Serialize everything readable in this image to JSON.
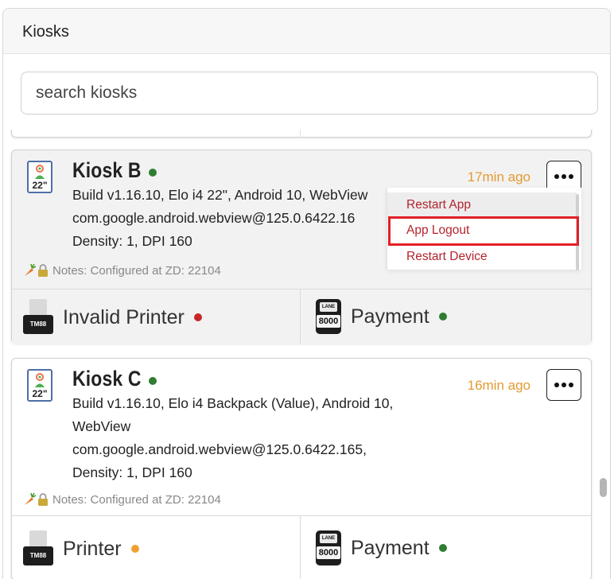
{
  "panel": {
    "title": "Kiosks"
  },
  "search": {
    "placeholder": "search kiosks"
  },
  "colors": {
    "online": "#2f7d32",
    "error": "#c62828",
    "warning": "#f0a030",
    "time": "#e39a33",
    "menu_text": "#b3242e",
    "highlight": "#e21f26"
  },
  "kiosks": [
    {
      "name": "Kiosk B",
      "status": "online",
      "device_size": "22\"",
      "details": "Build v1.16.10, Elo i4 22\", Android 10, WebView\ncom.google.android.webview@125.0.6422.16\nDensity: 1, DPI 160",
      "time_ago": "17min ago",
      "notes": "Notes: Configured at ZD: 22104",
      "printer": {
        "label": "Invalid Printer",
        "model": "TM88",
        "status": "error"
      },
      "payment": {
        "label": "Payment",
        "model": "8000",
        "brand": "LANE",
        "status": "online"
      }
    },
    {
      "name": "Kiosk C",
      "status": "online",
      "device_size": "22\"",
      "details": "Build v1.16.10, Elo i4 Backpack (Value), Android 10,\nWebView\ncom.google.android.webview@125.0.6422.165,\nDensity: 1, DPI 160",
      "time_ago": "16min ago",
      "notes": "Notes: Configured at ZD: 22104",
      "printer": {
        "label": "Printer",
        "model": "TM88",
        "status": "warning"
      },
      "payment": {
        "label": "Payment",
        "model": "8000",
        "brand": "LANE",
        "status": "online"
      }
    }
  ],
  "menu": {
    "items": [
      {
        "label": "Restart App"
      },
      {
        "label": "App Logout"
      },
      {
        "label": "Restart Device"
      }
    ]
  },
  "icons": {
    "more": "ellipsis-icon",
    "notes_carrot": "carrot-icon",
    "notes_lock": "lock-icon",
    "device": "tablet-icon",
    "printer": "printer-icon",
    "payment": "card-terminal-icon"
  }
}
